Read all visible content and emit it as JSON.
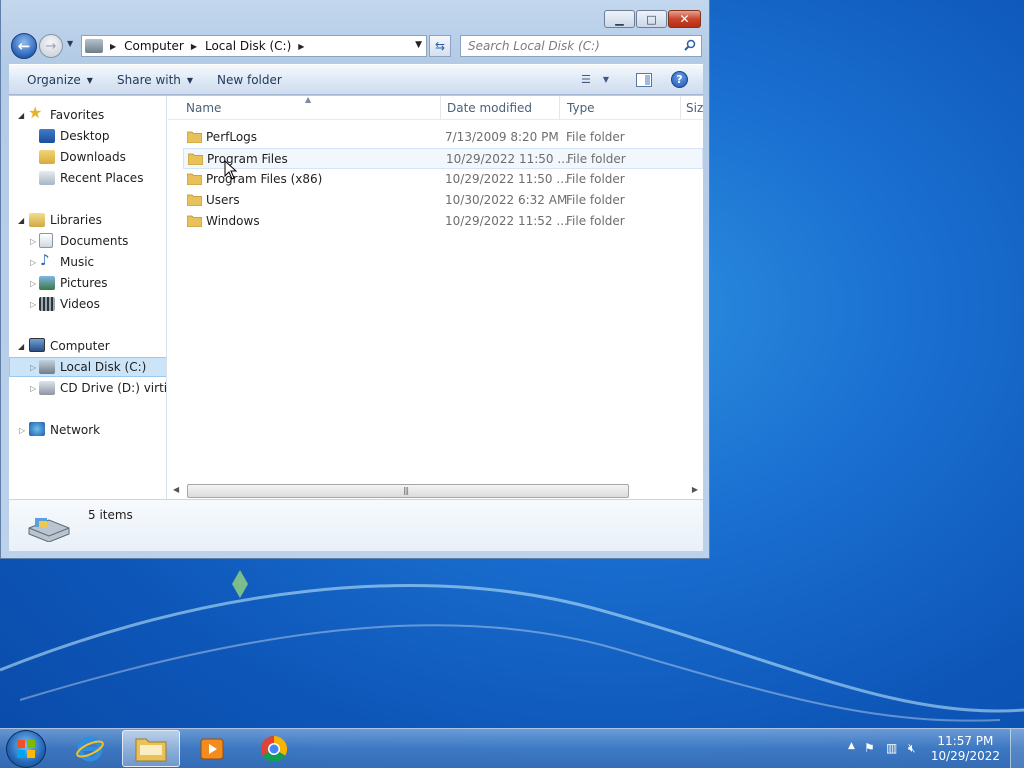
{
  "window": {
    "caption": {
      "minimize": "▁",
      "maximize": "□",
      "close": "✕"
    }
  },
  "nav": {
    "breadcrumbs": [
      "Computer",
      "Local Disk (C:)"
    ],
    "search_placeholder": "Search Local Disk (C:)"
  },
  "toolbar": {
    "organize": "Organize",
    "share_with": "Share with",
    "new_folder": "New folder",
    "help": "?"
  },
  "navpane": {
    "favorites": "Favorites",
    "desktop": "Desktop",
    "downloads": "Downloads",
    "recent_places": "Recent Places",
    "libraries": "Libraries",
    "documents": "Documents",
    "music": "Music",
    "pictures": "Pictures",
    "videos": "Videos",
    "computer": "Computer",
    "local_disk": "Local Disk (C:)",
    "cd_drive": "CD Drive (D:) virtio-w",
    "network": "Network"
  },
  "columns": {
    "name": "Name",
    "date": "Date modified",
    "type": "Type",
    "size": "Size"
  },
  "files": [
    {
      "name": "PerfLogs",
      "date": "7/13/2009 8:20 PM",
      "type": "File folder"
    },
    {
      "name": "Program Files",
      "date": "10/29/2022 11:50 ...",
      "type": "File folder"
    },
    {
      "name": "Program Files (x86)",
      "date": "10/29/2022 11:50 ...",
      "type": "File folder"
    },
    {
      "name": "Users",
      "date": "10/30/2022 6:32 AM",
      "type": "File folder"
    },
    {
      "name": "Windows",
      "date": "10/29/2022 11:52 ...",
      "type": "File folder"
    }
  ],
  "status": {
    "item_count": "5 items"
  },
  "taskbar": {
    "clock_time": "11:57 PM",
    "clock_date": "10/29/2022"
  },
  "colors": {
    "selection": "#cce4f7",
    "wallpaper": "#1a6fd0",
    "folder": "#e8c15a"
  }
}
